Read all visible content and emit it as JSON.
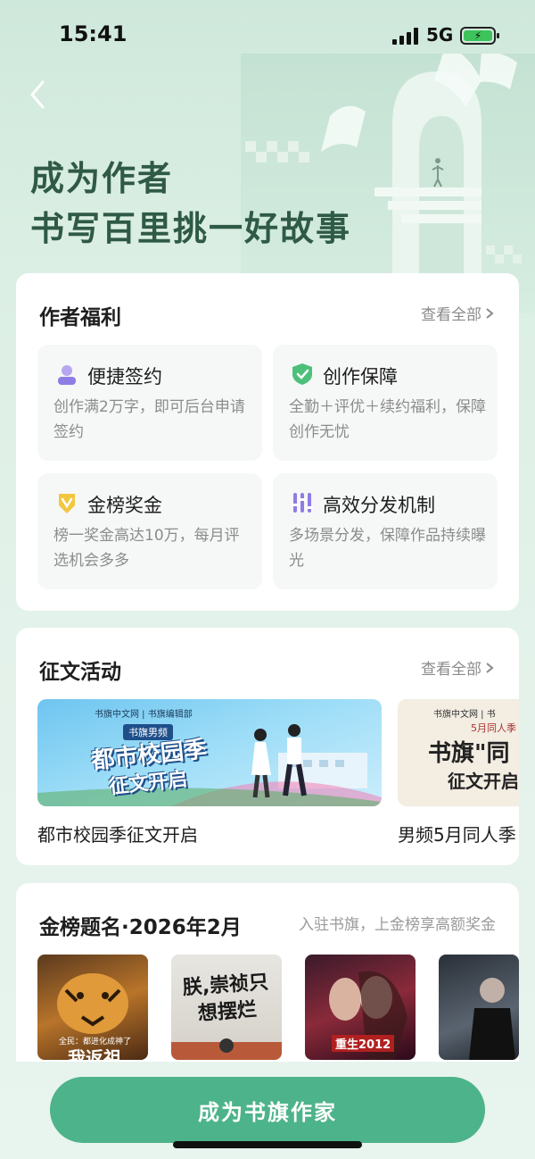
{
  "status": {
    "time": "15:41",
    "network": "5G"
  },
  "hero": {
    "line1": "成为作者",
    "line2": "书写百里挑一好故事"
  },
  "benefits": {
    "title": "作者福利",
    "view_all": "查看全部",
    "items": [
      {
        "title": "便捷签约",
        "desc": "创作满2万字，即可后台申请签约",
        "icon": "user-icon"
      },
      {
        "title": "创作保障",
        "desc": "全勤＋评优＋续约福利，保障创作无忧",
        "icon": "shield-check-icon"
      },
      {
        "title": "金榜奖金",
        "desc": "榜一奖金高达10万，每月评选机会多多",
        "icon": "medal-icon"
      },
      {
        "title": "高效分发机制",
        "desc": "多场景分发，保障作品持续曝光",
        "icon": "bars-icon"
      }
    ]
  },
  "contests": {
    "title": "征文活动",
    "view_all": "查看全部",
    "items": [
      {
        "label": "都市校园季征文开启",
        "banner_header": "书旗中文网 | 书旗编辑部",
        "banner_tag": "书旗男频",
        "banner_title": "都市校园季",
        "banner_subtitle": "征文开启"
      },
      {
        "label": "男频5月同人季",
        "banner_header": "书旗中文网 | 书",
        "banner_tag": "5月同人季",
        "banner_title": "书旗\"同",
        "banner_subtitle": "征文开启"
      }
    ]
  },
  "gold_list": {
    "title": "金榜题名·2026年2月",
    "subtitle": "入驻书旗，上金榜享高额奖金",
    "books": [
      {
        "cover_text": "我返祖",
        "cover_caption": "全民：都进化成神了"
      },
      {
        "cover_text": "朕,崇祯只想摆烂"
      },
      {
        "cover_text": "重生2012"
      },
      {
        "cover_text": ""
      }
    ]
  },
  "cta": {
    "label": "成为书旗作家"
  },
  "colors": {
    "accent": "#4db38a",
    "hero_text": "#2f5a45",
    "background": "#dcefe4"
  }
}
